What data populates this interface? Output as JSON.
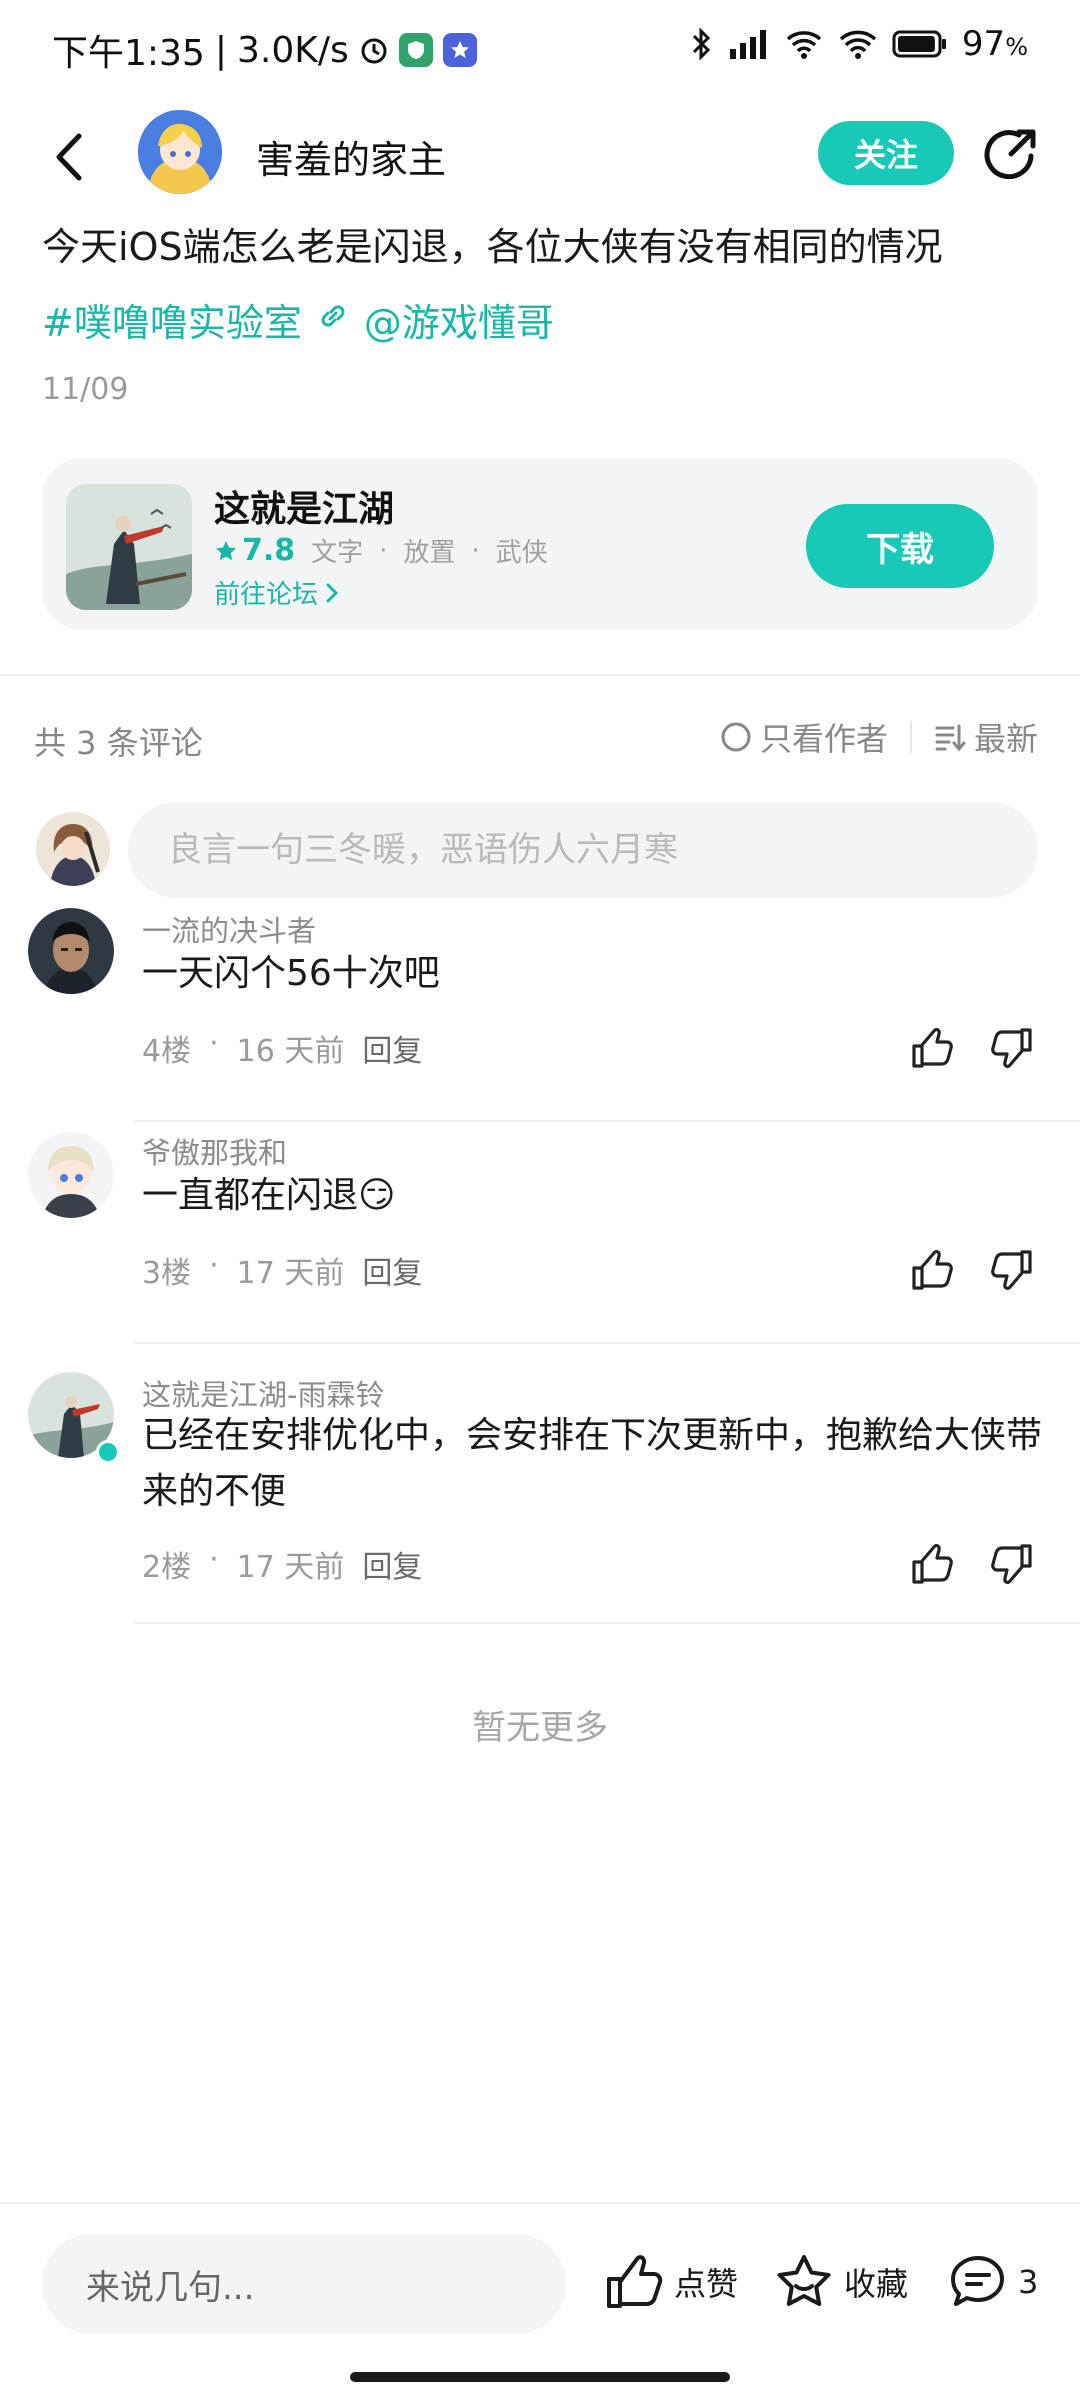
{
  "status_bar": {
    "time": "下午1:35",
    "speed": "3.0K/s",
    "battery": "97",
    "battery_unit": "%"
  },
  "header": {
    "author_name": "害羞的家主",
    "follow_label": "关注"
  },
  "post": {
    "text": "今天iOS端怎么老是闪退，各位大侠有没有相同的情况",
    "topic_tag": "#噗噜噜实验室",
    "mention": "@游戏懂哥",
    "date": "11/09"
  },
  "game_card": {
    "title": "这就是江湖",
    "rating": "7.8",
    "tags": [
      "文字",
      "放置",
      "武侠"
    ],
    "forum_link": "前往论坛",
    "download_label": "下载"
  },
  "comments_header": {
    "count_text": "共 3 条评论",
    "author_only": "只看作者",
    "sort": "最新"
  },
  "comment_input": {
    "placeholder": "良言一句三冬暖，恶语伤人六月寒"
  },
  "comments": [
    {
      "name": "一流的决斗者",
      "text": "一天闪个56十次吧",
      "floor": "4楼",
      "time": "16 天前",
      "reply": "回复"
    },
    {
      "name": "爷傲那我和",
      "text": "一直都在闪退😏",
      "floor": "3楼",
      "time": "17 天前",
      "reply": "回复"
    },
    {
      "name": "这就是江湖-雨霖铃",
      "text": "已经在安排优化中，会安排在下次更新中，抱歉给大侠带来的不便",
      "floor": "2楼",
      "time": "17 天前",
      "reply": "回复"
    }
  ],
  "no_more": "暂无更多",
  "bottom_bar": {
    "input_placeholder": "来说几句...",
    "like_label": "点赞",
    "collect_label": "收藏",
    "comment_count": "3"
  }
}
